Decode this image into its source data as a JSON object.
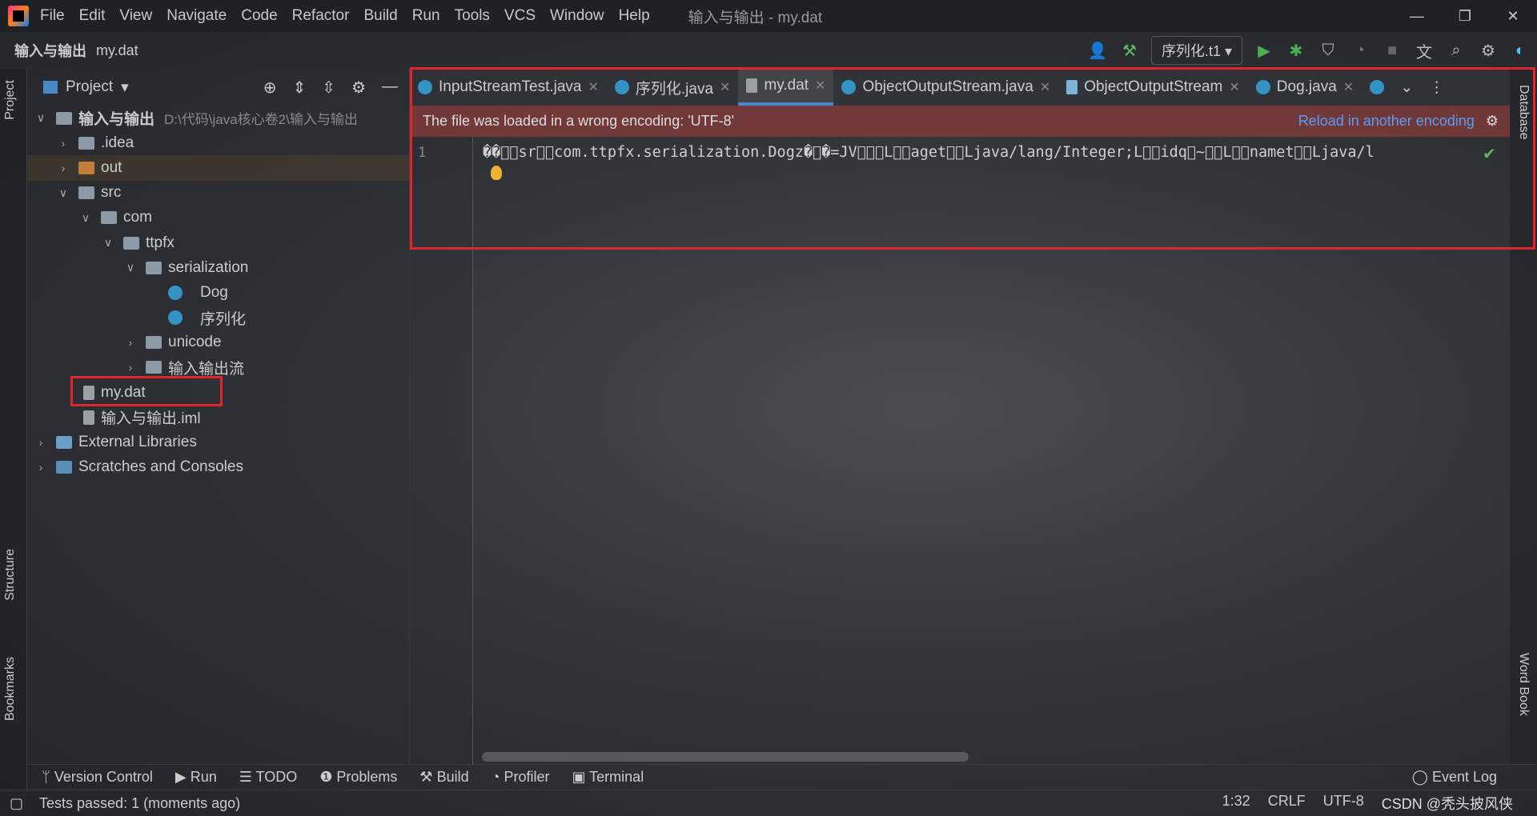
{
  "menubar": {
    "items": [
      "File",
      "Edit",
      "View",
      "Navigate",
      "Code",
      "Refactor",
      "Build",
      "Run",
      "Tools",
      "VCS",
      "Window",
      "Help"
    ],
    "title": "输入与输出 - my.dat"
  },
  "navbar": {
    "project": "输入与输出",
    "file": "my.dat",
    "run_config": "序列化.t1"
  },
  "side": {
    "project": "Project",
    "structure": "Structure",
    "bookmarks": "Bookmarks",
    "database": "Database",
    "wordbook": "Word Book"
  },
  "project": {
    "title": "Project",
    "rows": [
      {
        "label": "输入与输出",
        "path": "D:\\代码\\java核心卷2\\输入与输出"
      },
      {
        "label": ".idea"
      },
      {
        "label": "out"
      },
      {
        "label": "src"
      },
      {
        "label": "com"
      },
      {
        "label": "ttpfx"
      },
      {
        "label": "serialization"
      },
      {
        "label": "Dog"
      },
      {
        "label": "序列化"
      },
      {
        "label": "unicode"
      },
      {
        "label": "输入输出流"
      },
      {
        "label": "my.dat"
      },
      {
        "label": "输入与输出.iml"
      },
      {
        "label": "External Libraries"
      },
      {
        "label": "Scratches and Consoles"
      }
    ]
  },
  "tabs": [
    "InputStreamTest.java",
    "序列化.java",
    "my.dat",
    "ObjectOutputStream.java",
    "ObjectOutputStream",
    "Dog.java"
  ],
  "banner": {
    "text": "The file was loaded in a wrong encoding: 'UTF-8'",
    "link": "Reload in another encoding"
  },
  "editor": {
    "line": "1",
    "code": "��\u0000\u0005sr\u0000\u0016com.ttpfx.serialization.Dogz�\u0003�=JV\u0002\u0000\u0003L\u0000\u0003aget\u0000\u0013Ljava/lang/Integer;L\u0000\u0002idq\u0000~\u0000\u0001L\u0000\u0004namet\u0000\u0012Ljava/l"
  },
  "toolwindows": [
    "Version Control",
    "Run",
    "TODO",
    "Problems",
    "Build",
    "Profiler",
    "Terminal"
  ],
  "eventlog": "Event Log",
  "status": {
    "text": "Tests passed: 1 (moments ago)",
    "pos": "1:32",
    "sep": "CRLF",
    "enc": "UTF-8",
    "watermark": "CSDN @秃头披风侠"
  }
}
